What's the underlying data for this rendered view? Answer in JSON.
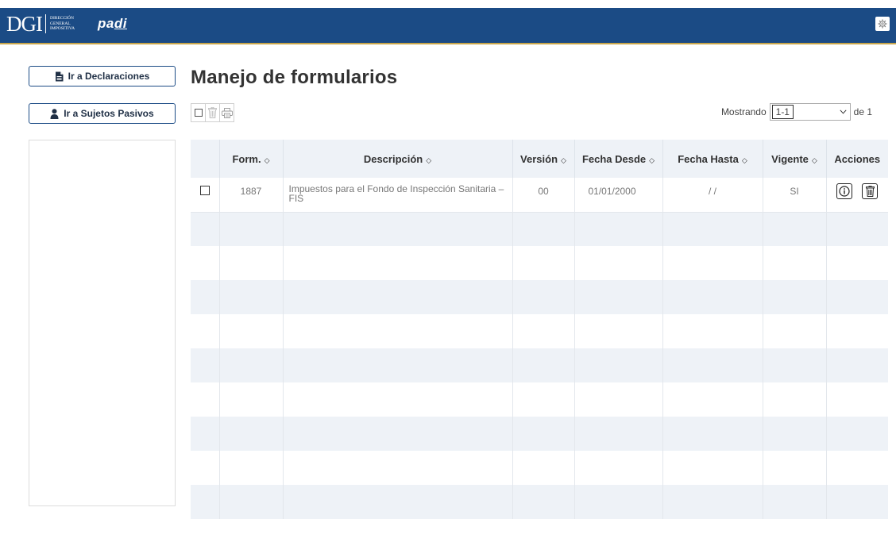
{
  "header": {
    "logo_main": "DGI",
    "logo_sub_1": "Dirección",
    "logo_sub_2": "General",
    "logo_sub_3": "Impositiva",
    "app_name_a": "pa",
    "app_name_b": "di"
  },
  "sidebar": {
    "btn_declaraciones": "Ir a Declaraciones",
    "btn_sujetos": "Ir a Sujetos Pasivos"
  },
  "page": {
    "title": "Manejo de formularios"
  },
  "pager": {
    "prefix": "Mostrando",
    "selected": "1-1",
    "suffix": "de 1"
  },
  "table": {
    "headers": [
      "Form.",
      "Descripción",
      "Versión",
      "Fecha Desde",
      "Fecha Hasta",
      "Vigente",
      "Acciones"
    ],
    "rows": [
      {
        "form": "1887",
        "descripcion": "Impuestos para el Fondo de Inspección Sanitaria – FIS",
        "version": "00",
        "desde": "01/01/2000",
        "hasta": "/ /",
        "vigente": "SI"
      }
    ]
  },
  "colors": {
    "header_bg": "#1b4b85",
    "accent": "#c9a64a",
    "row_alt": "#eef2f7"
  },
  "icons": [
    "settings-icon",
    "document-icon",
    "user-icon",
    "checkbox-icon",
    "trash-icon",
    "print-icon",
    "info-icon",
    "chevron-down-icon"
  ]
}
